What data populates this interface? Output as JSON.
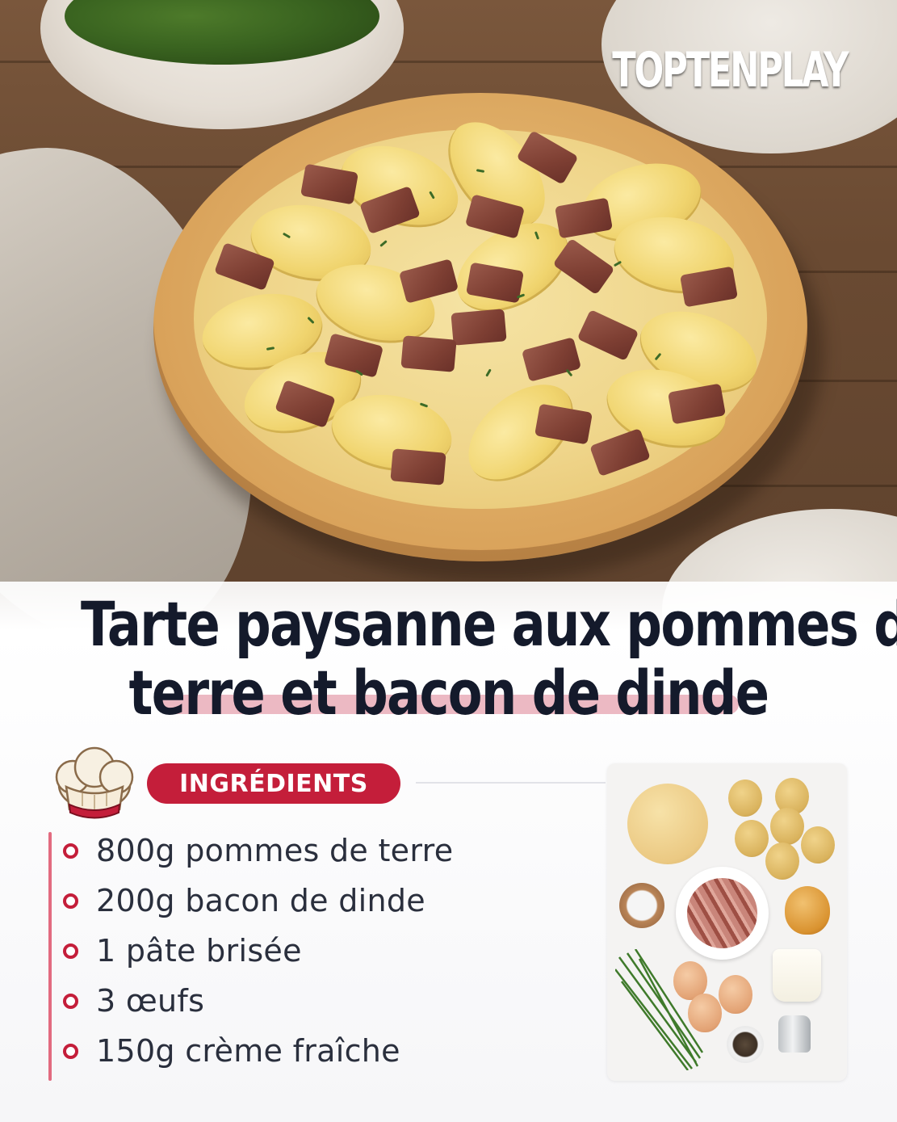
{
  "watermark": "TOPTENPLAY",
  "title": {
    "line1": "Tarte paysanne aux pommes de",
    "line2": "terre et bacon de dinde"
  },
  "ingredients_section": {
    "badge": "INGRÉDIENTS",
    "items": [
      "800g pommes de terre",
      "200g bacon de dinde",
      "1 pâte brisée",
      "3 œufs",
      "150g crème fraîche"
    ]
  },
  "colors": {
    "accent": "#c41e3a",
    "title": "#141a2b",
    "underline_highlight": "#e7a7b4",
    "list_bar": "#e26b80"
  },
  "icons": [
    "chef-hat-icon",
    "list-bullet-icon"
  ]
}
